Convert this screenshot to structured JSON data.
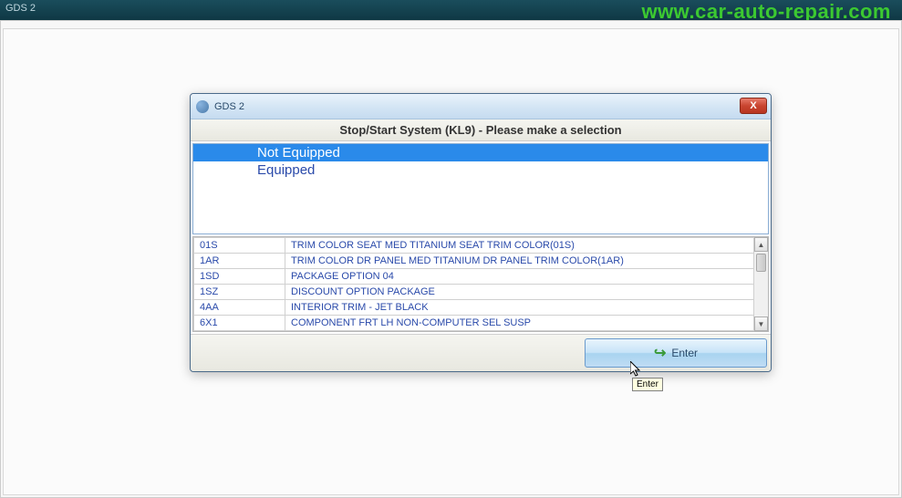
{
  "outer_window": {
    "title": "GDS 2"
  },
  "watermark": "www.car-auto-repair.com",
  "dialog": {
    "title": "GDS 2",
    "close_label": "X",
    "header": "Stop/Start System (KL9) - Please make a selection",
    "selection_items": [
      {
        "label": "Not Equipped",
        "selected": true
      },
      {
        "label": "Equipped",
        "selected": false
      }
    ],
    "options": [
      {
        "code": "01S",
        "desc": "TRIM COLOR SEAT MED TITANIUM SEAT TRIM COLOR(01S)"
      },
      {
        "code": "1AR",
        "desc": "TRIM COLOR DR PANEL MED TITANIUM DR PANEL TRIM COLOR(1AR)"
      },
      {
        "code": "1SD",
        "desc": "PACKAGE OPTION 04"
      },
      {
        "code": "1SZ",
        "desc": "DISCOUNT OPTION PACKAGE"
      },
      {
        "code": "4AA",
        "desc": "INTERIOR TRIM - JET BLACK"
      },
      {
        "code": "6X1",
        "desc": "COMPONENT FRT LH NON-COMPUTER SEL SUSP"
      }
    ],
    "enter_label": "Enter",
    "scroll_up": "▲",
    "scroll_down": "▼"
  },
  "tooltip": "Enter"
}
